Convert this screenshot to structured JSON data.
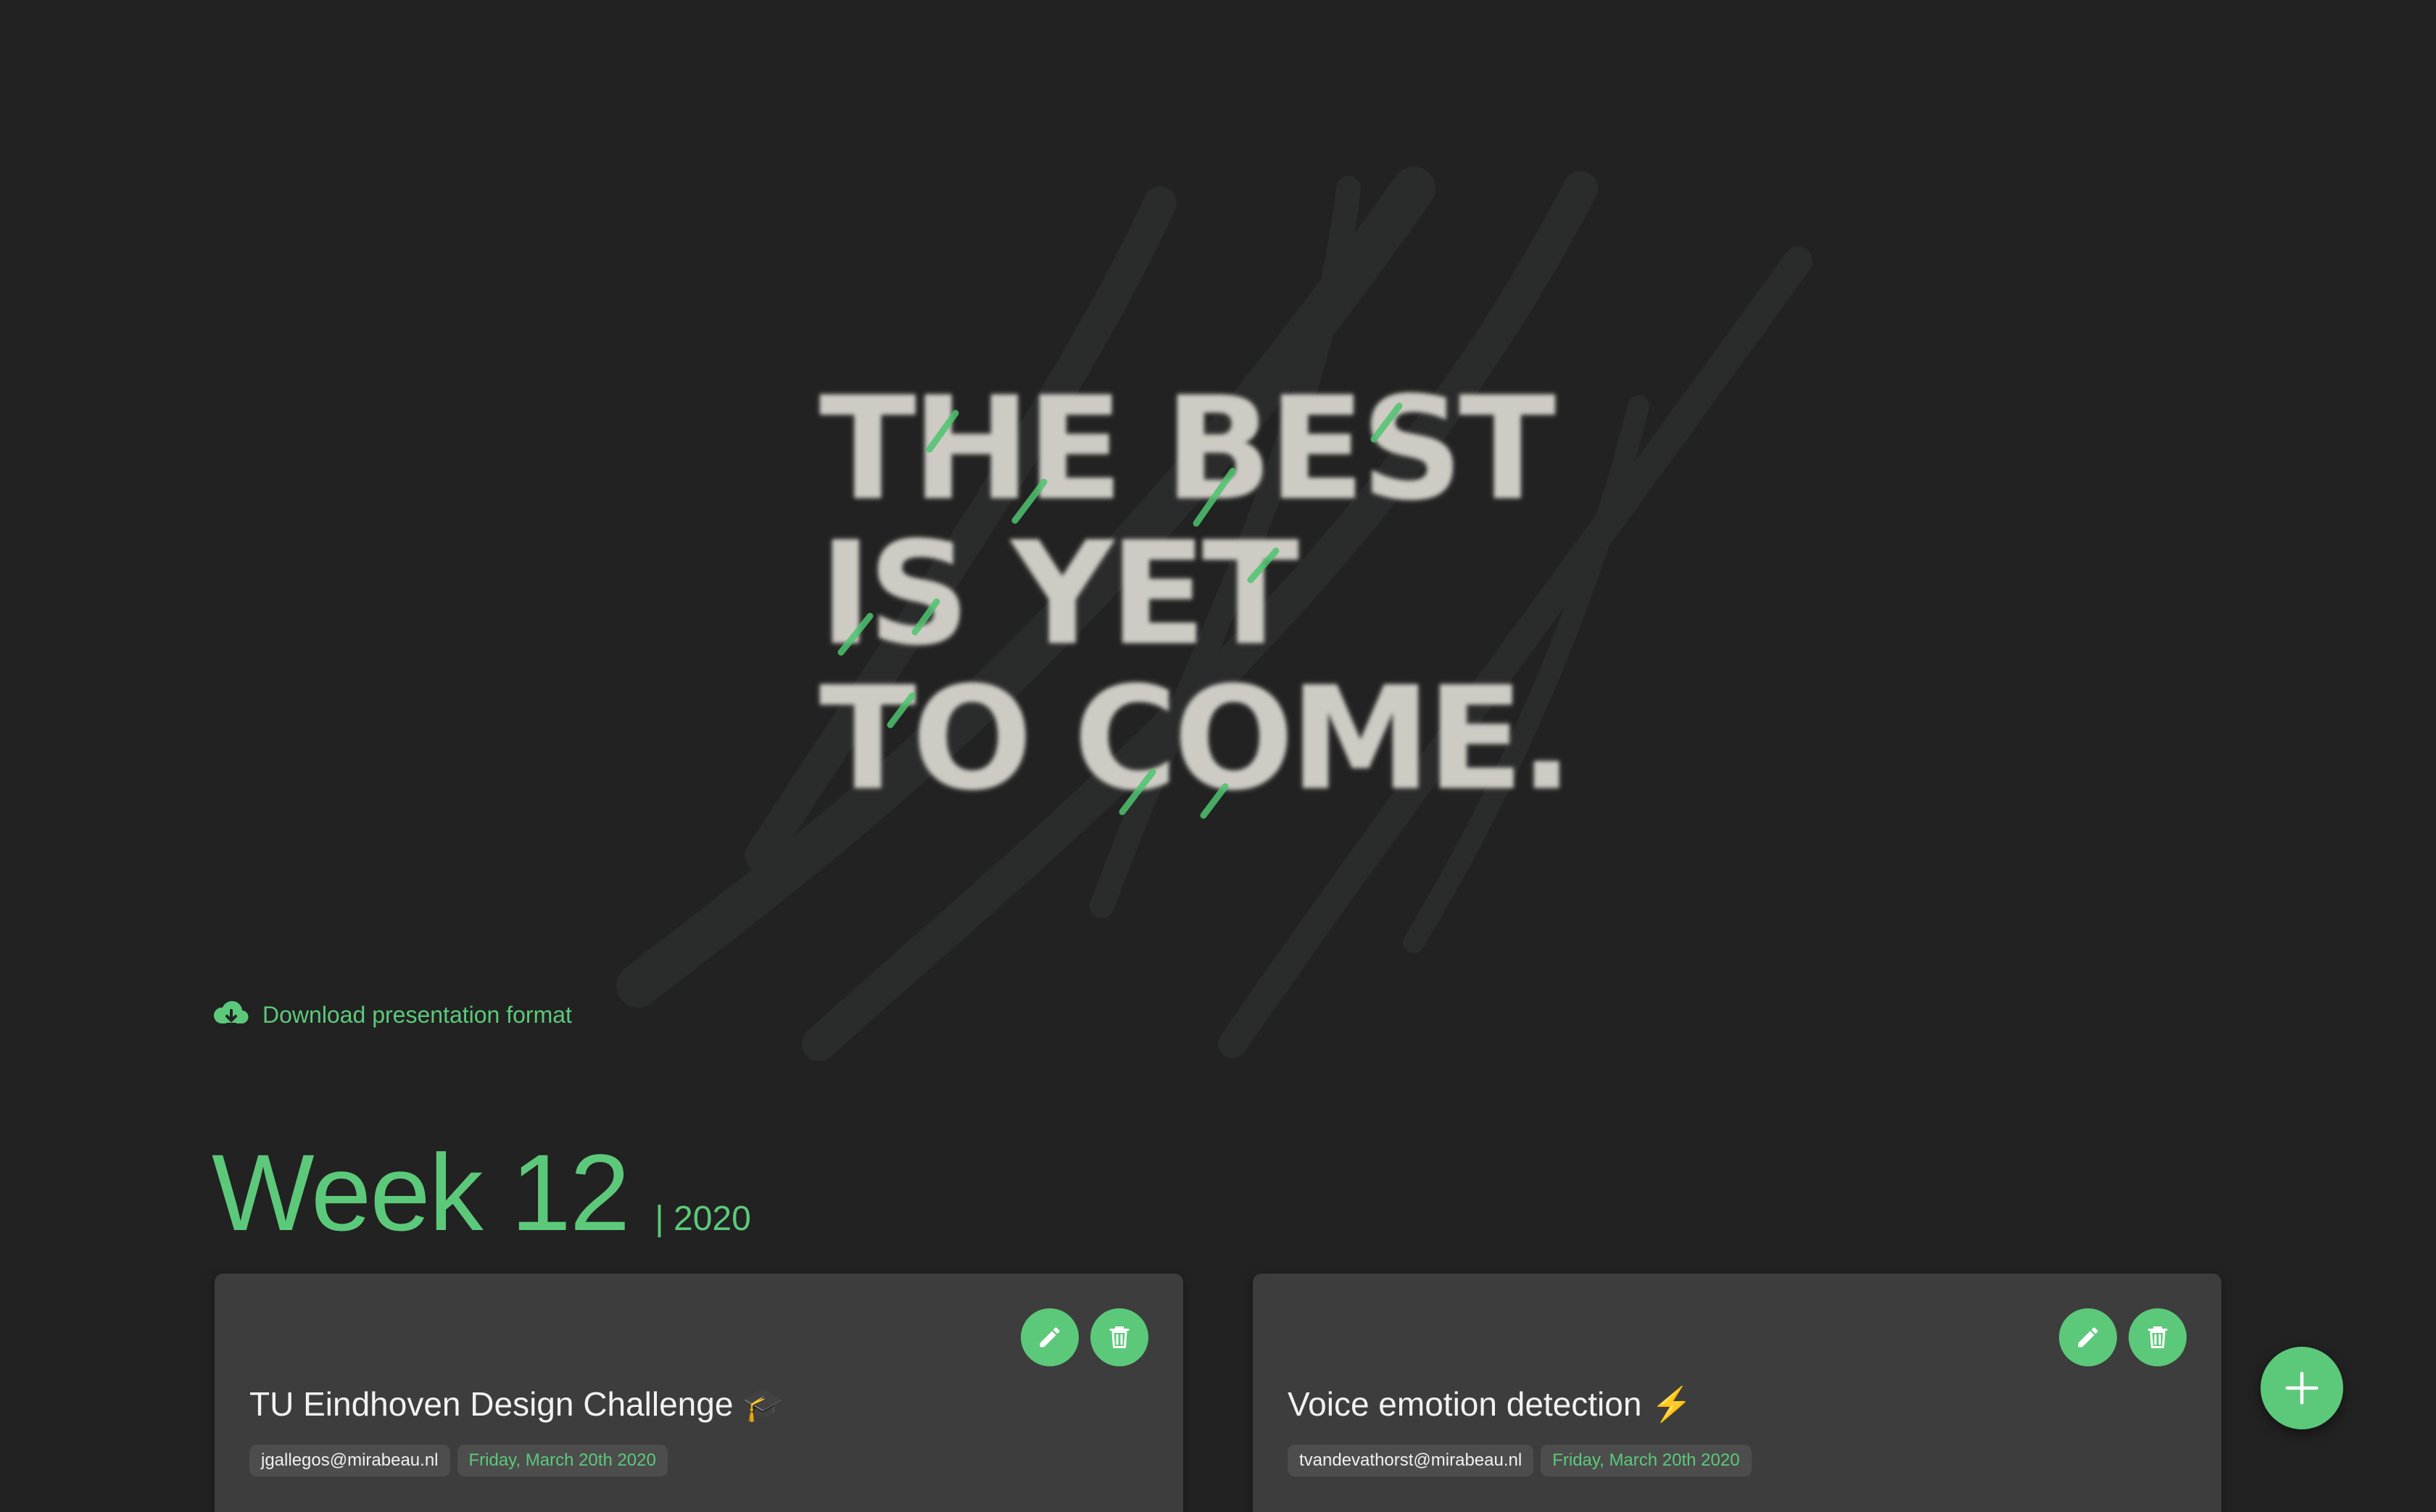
{
  "hero": {
    "headline_lines": [
      "THE BEST",
      "IS YET",
      "TO COME."
    ]
  },
  "download": {
    "label": "Download presentation format",
    "icon": "cloud-download-icon"
  },
  "week": {
    "title": "Week 12",
    "year": "| 2020"
  },
  "cards": [
    {
      "title": "TU Eindhoven Design Challenge 🎓",
      "email": "jgallegos@mirabeau.nl",
      "date": "Friday, March 20th 2020",
      "edit_icon": "pencil-icon",
      "delete_icon": "trash-icon"
    },
    {
      "title": "Voice emotion detection ⚡",
      "email": "tvandevathorst@mirabeau.nl",
      "date": "Friday, March 20th 2020",
      "edit_icon": "pencil-icon",
      "delete_icon": "trash-icon"
    }
  ],
  "fab": {
    "icon": "plus-icon"
  },
  "colors": {
    "background": "#222222",
    "accent": "#5cc97a",
    "card": "#3d3d3d",
    "chip": "#4d4d4d",
    "headline": "#cdcbc4"
  }
}
